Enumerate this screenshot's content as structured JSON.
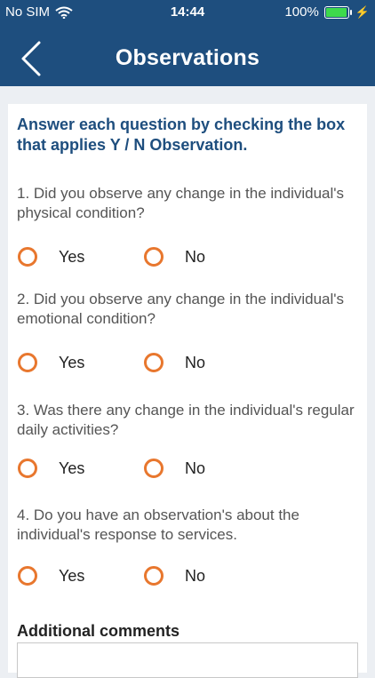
{
  "status_bar": {
    "carrier": "No SIM",
    "time": "14:44",
    "battery": "100%",
    "battery_level": 1.0
  },
  "header": {
    "title": "Observations"
  },
  "instructions": "Answer each question by checking the box that applies Y / N Observation.",
  "questions": [
    {
      "text": "1. Did you observe any change in the individual's physical condition?",
      "yes": "Yes",
      "no": "No"
    },
    {
      "text": "2. Did you observe any change in the individual's emotional condition?",
      "yes": "Yes",
      "no": "No"
    },
    {
      "text": "3. Was there any change in the individual's regular daily activities?",
      "yes": "Yes",
      "no": "No"
    },
    {
      "text": "4. Do you have an observation's about the individual's response to services.",
      "yes": "Yes",
      "no": "No"
    }
  ],
  "comments": {
    "label": "Additional comments",
    "value": ""
  },
  "colors": {
    "header": "#1e4e7e",
    "accent": "#e8772e",
    "battery": "#3dd94c"
  }
}
